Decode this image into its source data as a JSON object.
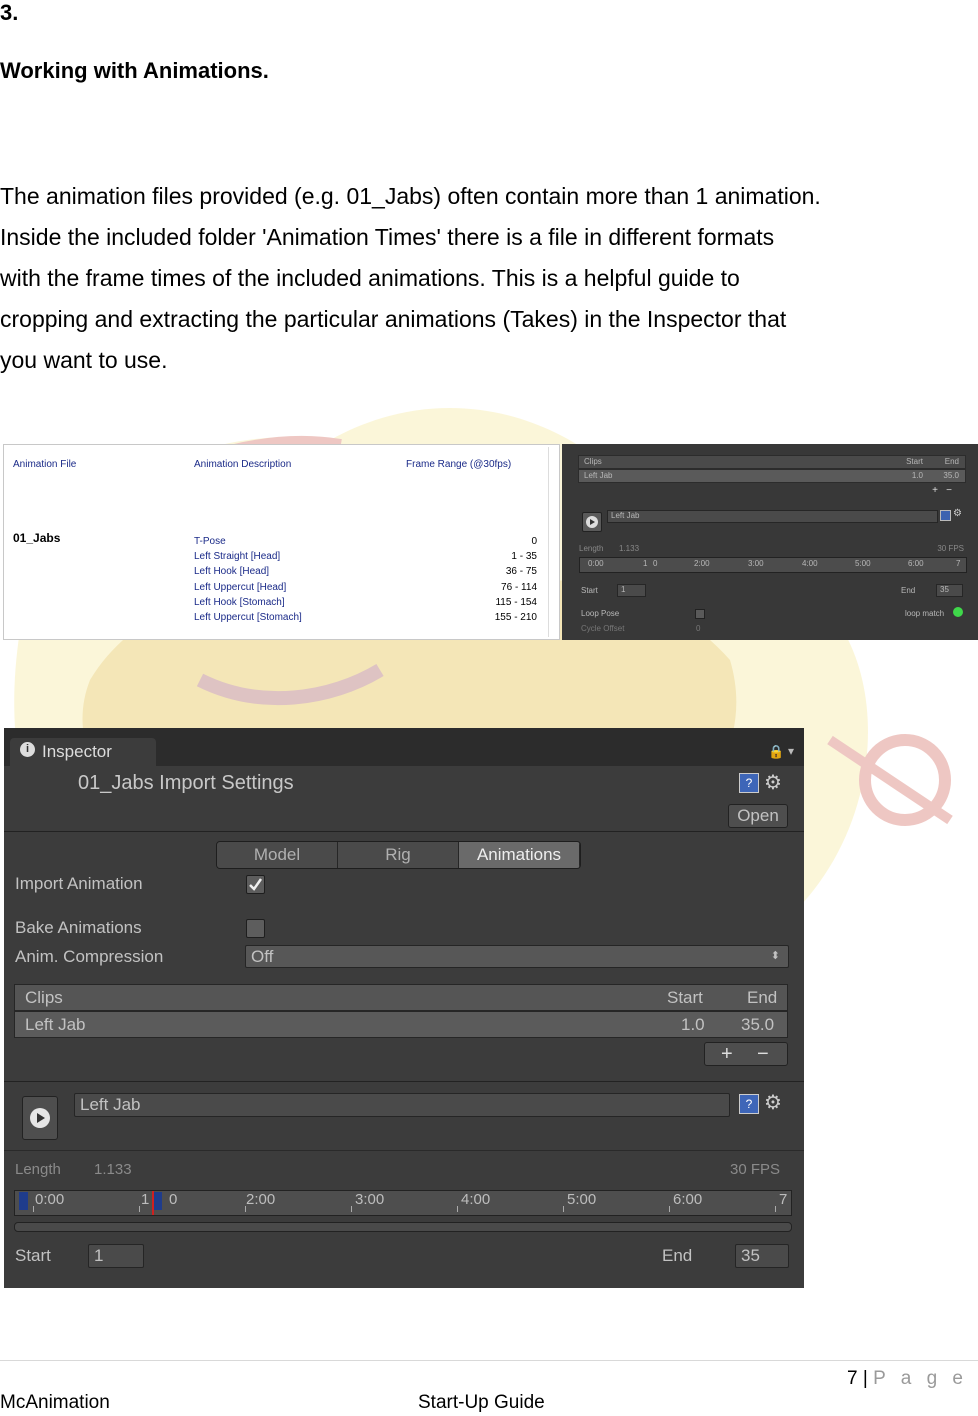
{
  "section_number": "3.",
  "section_title": "Working with Animations.",
  "paragraph_lines": [
    "The animation files provided (e.g. 01_Jabs) often contain more than 1 animation.",
    "Inside the included folder 'Animation Times' there is a file in different formats",
    "with the frame times of the included animations.  This is a helpful guide to",
    "cropping and extracting the particular animations (Takes) in the Inspector that",
    "you want to use."
  ],
  "anim_table": {
    "headers": [
      "Animation File",
      "Animation Description",
      "Frame Range (@30fps)"
    ],
    "file": "01_Jabs",
    "rows": [
      {
        "desc": "T-Pose",
        "range": "0"
      },
      {
        "desc": "Left Straight [Head]",
        "range": "1 - 35"
      },
      {
        "desc": "Left Hook [Head]",
        "range": "36 - 75"
      },
      {
        "desc": "Left Uppercut [Head]",
        "range": "76 - 114"
      },
      {
        "desc": "Left Hook [Stomach]",
        "range": "115 - 154"
      },
      {
        "desc": "Left Uppercut [Stomach]",
        "range": "155 - 210"
      }
    ]
  },
  "mini_inspector": {
    "clips_label": "Clips",
    "start_label": "Start",
    "end_label": "End",
    "clip_name": "Left Jab",
    "clip_start": "1.0",
    "clip_end": "35.0",
    "plus": "+",
    "minus": "−",
    "name_field": "Left Jab",
    "length_label": "Length",
    "length_value": "1.133",
    "fps": "30 FPS",
    "timeline_labels": [
      "0:00",
      "1",
      "0",
      "2:00",
      "3:00",
      "4:00",
      "5:00",
      "6:00",
      "7"
    ],
    "start_value": "1",
    "end_value": "35",
    "loop_pose": "Loop Pose",
    "loop_match": "loop match",
    "cycle_offset": "Cycle Offset",
    "cycle_offset_value": "0"
  },
  "inspector": {
    "tab_label": "Inspector",
    "title": "01_Jabs Import Settings",
    "open_label": "Open",
    "tabs": [
      "Model",
      "Rig",
      "Animations"
    ],
    "import_animation_label": "Import Animation",
    "import_animation_checked": true,
    "bake_animations_label": "Bake Animations",
    "bake_animations_checked": false,
    "anim_compression_label": "Anim. Compression",
    "anim_compression_value": "Off",
    "clips_label": "Clips",
    "start_label": "Start",
    "end_label": "End",
    "clip_name": "Left Jab",
    "clip_start": "1.0",
    "clip_end": "35.0",
    "plus": "+",
    "minus": "−",
    "name_field": "Left Jab",
    "length_label": "Length",
    "length_value": "1.133",
    "fps": "30 FPS",
    "timeline_labels": [
      "0:00",
      "1",
      "0",
      "2:00",
      "3:00",
      "4:00",
      "5:00",
      "6:00",
      "7"
    ],
    "start_field_label": "Start",
    "start_value": "1",
    "end_field_label": "End",
    "end_value": "35"
  },
  "footer": {
    "page_number": "7",
    "separator": "|",
    "page_word": "P a g e",
    "left": "McAnimation",
    "center": "Start-Up Guide"
  }
}
